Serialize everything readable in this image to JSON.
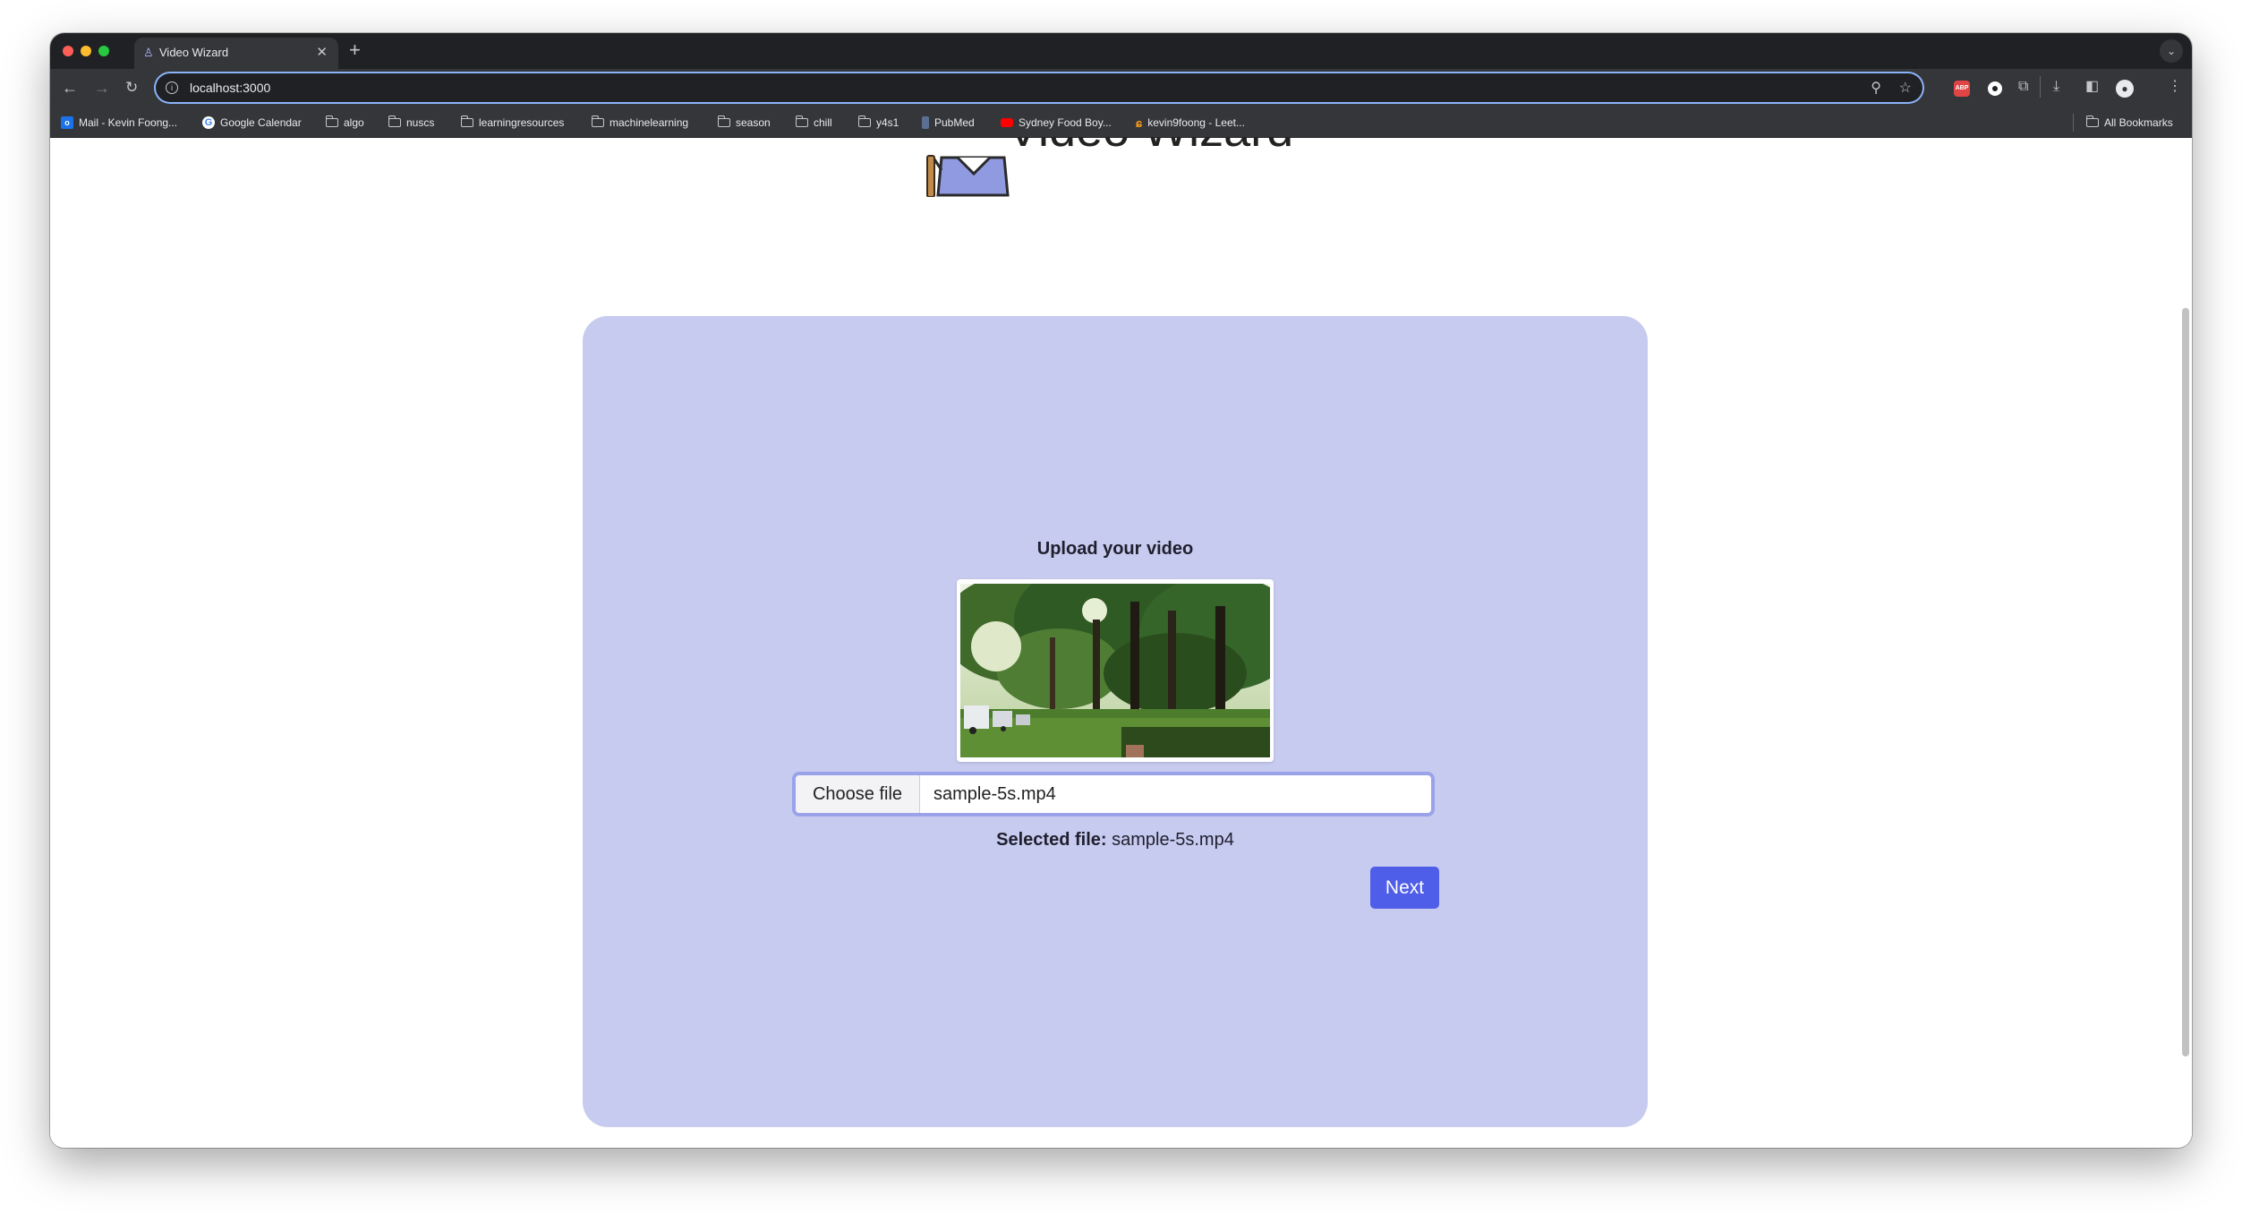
{
  "browser": {
    "tab_title": "Video Wizard",
    "tab_favicon": "wizard-icon",
    "url": "localhost:3000",
    "bookmarks": [
      {
        "label": "Mail - Kevin Foong...",
        "icon": "outlook-icon"
      },
      {
        "label": "Google Calendar",
        "icon": "google-icon"
      },
      {
        "label": "algo",
        "icon": "folder-icon"
      },
      {
        "label": "nuscs",
        "icon": "folder-icon"
      },
      {
        "label": "learningresources",
        "icon": "folder-icon"
      },
      {
        "label": "machinelearning",
        "icon": "folder-icon"
      },
      {
        "label": "season",
        "icon": "folder-icon"
      },
      {
        "label": "chill",
        "icon": "folder-icon"
      },
      {
        "label": "y4s1",
        "icon": "folder-icon"
      },
      {
        "label": "PubMed",
        "icon": "pubmed-icon"
      },
      {
        "label": "Sydney Food Boy...",
        "icon": "youtube-icon"
      },
      {
        "label": "kevin9foong - Leet...",
        "icon": "leetcode-icon"
      }
    ],
    "all_bookmarks_label": "All Bookmarks",
    "ext_abp_label": "ABP"
  },
  "page": {
    "brand_title": "Video Wizard",
    "upload": {
      "heading": "Upload your video",
      "choose_file_label": "Choose file",
      "file_name": "sample-5s.mp4",
      "selected_label": "Selected file:",
      "selected_value": "sample-5s.mp4",
      "next_label": "Next"
    }
  },
  "colors": {
    "card_bg": "#c7cbef",
    "accent": "#4f5ee8",
    "input_border": "#9aa3ea"
  }
}
